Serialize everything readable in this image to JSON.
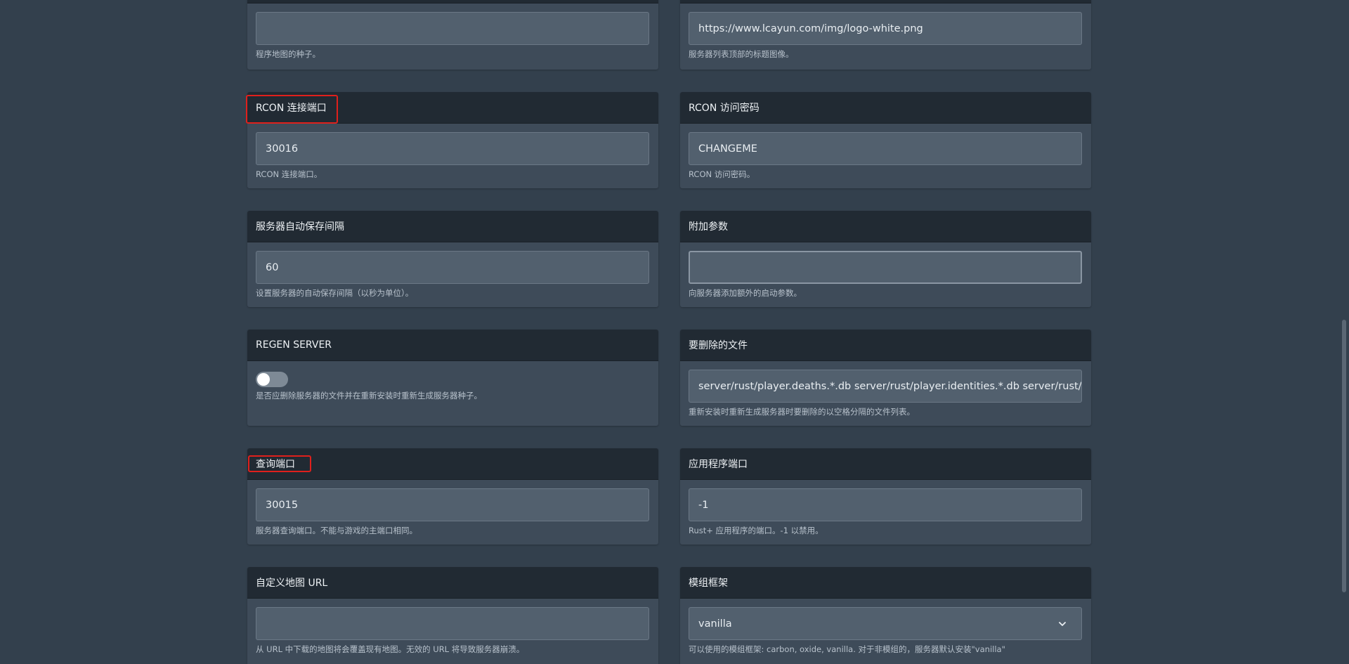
{
  "seed_card": {
    "input_value": "",
    "help": "程序地图的种子。"
  },
  "header_image_card": {
    "input_value": "https://www.lcayun.com/img/logo-white.png",
    "help": "服务器列表顶部的标题图像。"
  },
  "rcon_port": {
    "title": "RCON 连接端口",
    "input_value": "30016",
    "help": "RCON 连接端口。"
  },
  "rcon_password": {
    "title": "RCON 访问密码",
    "input_value": "CHANGEME",
    "help": "RCON 访问密码。"
  },
  "autosave": {
    "title": "服务器自动保存间隔",
    "input_value": "60",
    "help": "设置服务器的自动保存间隔（以秒为单位）。"
  },
  "extra_args": {
    "title": "附加参数",
    "input_value": "",
    "help": "向服务器添加额外的启动参数。"
  },
  "regen_server": {
    "title": "REGEN SERVER",
    "toggle_on": false,
    "help": "是否应删除服务器的文件并在重新安装时重新生成服务器种子。"
  },
  "files_to_delete": {
    "title": "要删除的文件",
    "input_value": "server/rust/player.deaths.*.db server/rust/player.identities.*.db server/rust/player.",
    "help": "重新安装时重新生成服务器时要删除的以空格分隔的文件列表。"
  },
  "query_port": {
    "title": "查询端口",
    "input_value": "30015",
    "help": "服务器查询端口。不能与游戏的主端口相同。"
  },
  "app_port": {
    "title": "应用程序端口",
    "input_value": "-1",
    "help": "Rust+ 应用程序的端口。-1 以禁用。"
  },
  "custom_map": {
    "title": "自定义地图 URL",
    "input_value": "",
    "help": "从 URL 中下载的地图将会覆盖现有地图。无效的 URL 将导致服务器崩溃。"
  },
  "mod_framework": {
    "title": "模组框架",
    "selected": "vanilla",
    "help": "可以使用的模组框架: carbon, oxide, vanilla. 对于非模组的，服务器默认安装\"vanilla\""
  },
  "colors": {
    "background": "#33404d",
    "card": "#3e4b59",
    "card_header": "#212a33",
    "input": "#52606e",
    "highlight": "#e0201c"
  },
  "icons": {
    "select": "chevron-down-icon"
  }
}
